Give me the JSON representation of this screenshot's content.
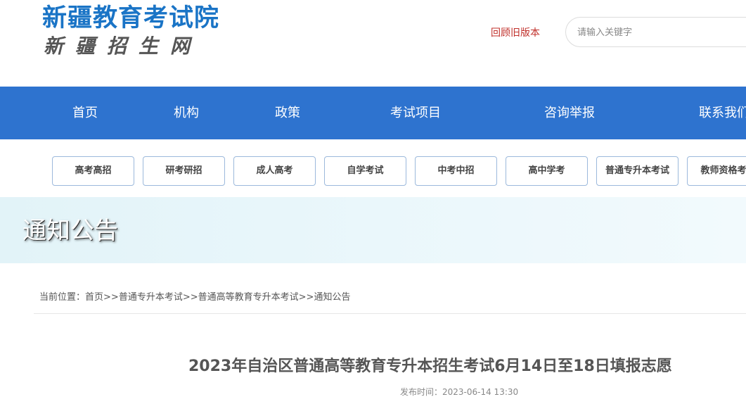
{
  "header": {
    "logo_title": "新疆教育考试院",
    "logo_subtitle": "新疆招生网",
    "old_version_link": "回顾旧版本",
    "search_placeholder": "请输入关键字"
  },
  "main_nav": {
    "items": [
      "首页",
      "机构",
      "政策",
      "考试项目",
      "咨询举报",
      "联系我们"
    ]
  },
  "sub_nav": {
    "items": [
      "高考高招",
      "研考研招",
      "成人高考",
      "自学考试",
      "中考中招",
      "高中学考",
      "普通专升本考试",
      "教师资格考试"
    ]
  },
  "banner": {
    "title": "通知公告"
  },
  "breadcrumb": {
    "prefix": "当前位置：",
    "separator": ">>",
    "items": [
      "首页",
      "普通专升本考试",
      "普通高等教育专升本考试",
      "通知公告"
    ]
  },
  "article": {
    "title": "2023年自治区普通高等教育专升本招生考试6月14日至18日填报志愿",
    "publish_time": "发布时间：2023-06-14 13:30"
  },
  "colors": {
    "brand_blue": "#1a74c6",
    "nav_blue": "#2e73cf",
    "old_version_red": "#c0302b",
    "sub_nav_border": "#9cb9dc"
  }
}
